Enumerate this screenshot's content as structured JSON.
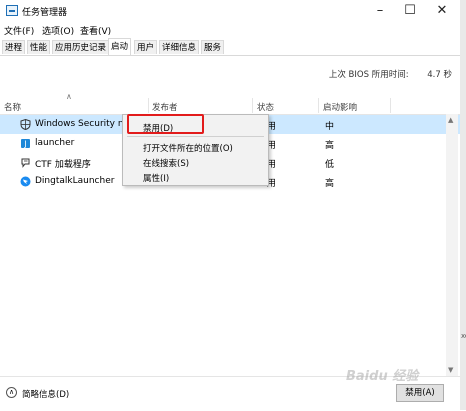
{
  "window": {
    "title": "任务管理器"
  },
  "menu": [
    "文件(F)",
    "选项(O)",
    "查看(V)"
  ],
  "tabs": [
    "进程",
    "性能",
    "应用历史记录",
    "启动",
    "用户",
    "详细信息",
    "服务"
  ],
  "active_tab": "启动",
  "bios": {
    "label": "上次 BIOS 所用时间:",
    "value": "4.7 秒"
  },
  "columns": {
    "name": "名称",
    "publisher": "发布者",
    "status": "状态",
    "impact": "启动影响"
  },
  "rows": [
    {
      "name": "Windows Security not",
      "icon": "shield-icon",
      "status": "用",
      "impact": "中"
    },
    {
      "name": "launcher",
      "icon": "launcher-icon",
      "status": "用",
      "impact": "高"
    },
    {
      "name": "CTF 加载程序",
      "icon": "ctf-icon",
      "status": "用",
      "impact": "低"
    },
    {
      "name": "DingtalkLauncher",
      "icon": "dingtalk-icon",
      "status": "用",
      "impact": "高"
    }
  ],
  "context_menu": [
    "禁用(D)",
    "打开文件所在的位置(O)",
    "在线搜索(S)",
    "属性(I)"
  ],
  "footer": {
    "fewer_details": "简略信息(D)",
    "disable_button": "禁用(A)"
  },
  "watermark": "Baidu 经验",
  "edge_text": "xe",
  "colors": {
    "selection": "#cce8ff",
    "highlight_box": "#e21b1b",
    "accent": "#1f6fb5"
  }
}
